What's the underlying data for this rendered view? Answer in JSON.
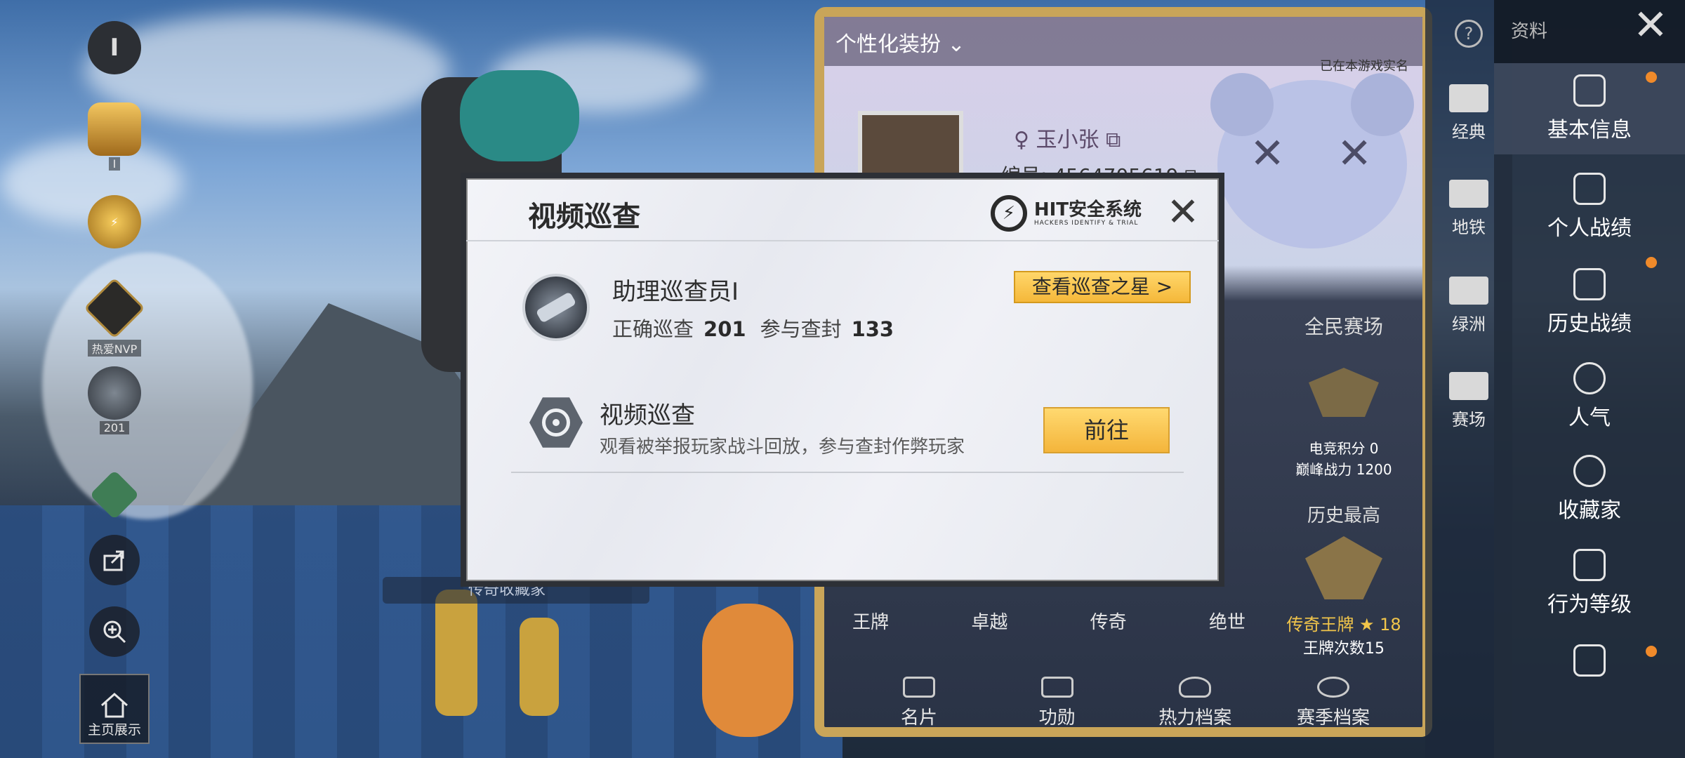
{
  "left_column": {
    "items": [
      {
        "caption": "I"
      },
      {
        "caption": "I"
      },
      {
        "caption": ""
      },
      {
        "caption": "热爱NVP"
      },
      {
        "caption": "201"
      },
      {
        "caption": ""
      }
    ],
    "share_label": "",
    "zoom_label": "",
    "home_label": "主页展示"
  },
  "scene": {
    "title_tag": "传奇收藏家"
  },
  "profile_card": {
    "persona_label": "个性化装扮",
    "realname_label": "已在本游戏实名",
    "player_name": "玉小张",
    "player_id": "编号: 4564705619",
    "mode_label": "全民赛场",
    "esports_score": "电竞积分 0",
    "peak_power": "巅峰战力 1200",
    "history_high_label": "历史最高",
    "rank_label": "传奇王牌",
    "rank_count": "18",
    "ace_count": "王牌次数15",
    "ranks": [
      "王牌",
      "卓越",
      "传奇",
      "绝世"
    ],
    "tabs": [
      "名片",
      "功勋",
      "热力档案",
      "赛季档案"
    ]
  },
  "nav_mid": {
    "items": [
      "经典",
      "地铁",
      "绿洲",
      "赛场"
    ]
  },
  "nav_right": {
    "top_label": "资料",
    "items": [
      "基本信息",
      "个人战绩",
      "历史战绩",
      "人气",
      "收藏家",
      "行为等级",
      ""
    ]
  },
  "modal": {
    "title": "视频巡查",
    "hit_main": "HIT安全系统",
    "hit_sub": "HACKERS IDENTIFY & TRIAL",
    "rank_title": "助理巡查员I",
    "correct_label": "正确巡查",
    "correct_value": "201",
    "participate_label": "参与查封",
    "participate_value": "133",
    "star_button": "查看巡查之星 >",
    "task_title": "视频巡查",
    "task_desc": "观看被举报玩家战斗回放，参与查封作弊玩家",
    "go_button": "前往",
    "close_glyph": "✕"
  }
}
